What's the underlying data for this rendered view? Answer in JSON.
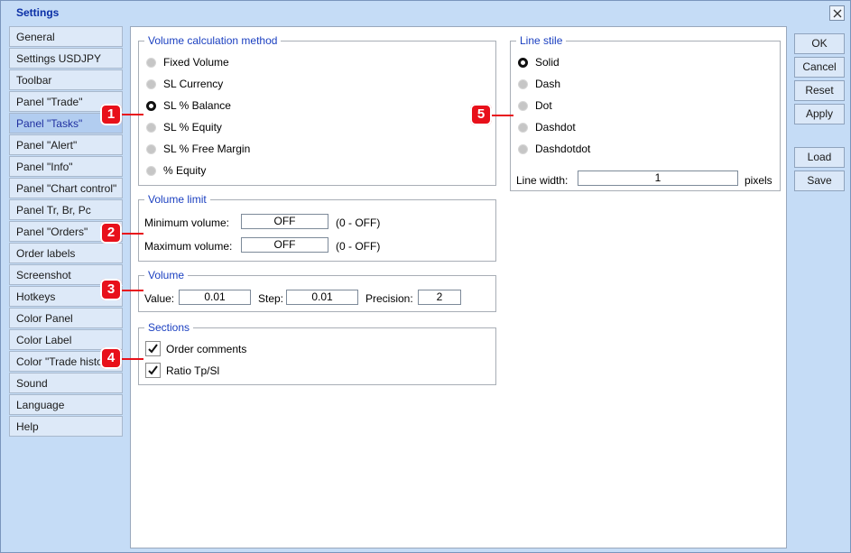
{
  "window": {
    "title": "Settings"
  },
  "sidebar": {
    "items": [
      {
        "label": "General"
      },
      {
        "label": "Settings USDJPY"
      },
      {
        "label": "Toolbar"
      },
      {
        "label": "Panel \"Trade\""
      },
      {
        "label": "Panel \"Tasks\"",
        "active": true
      },
      {
        "label": "Panel \"Alert\""
      },
      {
        "label": "Panel \"Info\""
      },
      {
        "label": "Panel \"Chart control\""
      },
      {
        "label": "Panel Tr, Br, Pc"
      },
      {
        "label": "Panel \"Orders\""
      },
      {
        "label": "Order labels"
      },
      {
        "label": "Screenshot"
      },
      {
        "label": "Hotkeys"
      },
      {
        "label": "Color Panel"
      },
      {
        "label": "Color Label"
      },
      {
        "label": "Color \"Trade history\""
      },
      {
        "label": "Sound"
      },
      {
        "label": "Language"
      },
      {
        "label": "Help"
      }
    ]
  },
  "volume_method": {
    "title": "Volume calculation method",
    "options": [
      "Fixed Volume",
      "SL Currency",
      "SL % Balance",
      "SL % Equity",
      "SL % Free Margin",
      "% Equity"
    ],
    "selected": "SL % Balance"
  },
  "volume_limit": {
    "title": "Volume limit",
    "min_label": "Minimum volume:",
    "min_value": "OFF",
    "min_hint": "(0 - OFF)",
    "max_label": "Maximum volume:",
    "max_value": "OFF",
    "max_hint": "(0 - OFF)"
  },
  "volume": {
    "title": "Volume",
    "value_label": "Value:",
    "value": "0.01",
    "step_label": "Step:",
    "step": "0.01",
    "precision_label": "Precision:",
    "precision": "2"
  },
  "sections": {
    "title": "Sections",
    "items": [
      {
        "label": "Order comments",
        "checked": true
      },
      {
        "label": "Ratio Tp/Sl",
        "checked": true
      }
    ]
  },
  "line_style": {
    "title": "Line stile",
    "options": [
      "Solid",
      "Dash",
      "Dot",
      "Dashdot",
      "Dashdotdot"
    ],
    "selected": "Solid",
    "width_label": "Line width:",
    "width_value": "1",
    "width_unit": "pixels"
  },
  "buttons": {
    "ok": "OK",
    "cancel": "Cancel",
    "reset": "Reset",
    "apply": "Apply",
    "load": "Load",
    "save": "Save"
  },
  "markers": [
    "1",
    "2",
    "3",
    "4",
    "5"
  ],
  "colors": {
    "accent": "#1a3fc0",
    "marker": "#e8101a",
    "background": "#c5dcf6"
  }
}
